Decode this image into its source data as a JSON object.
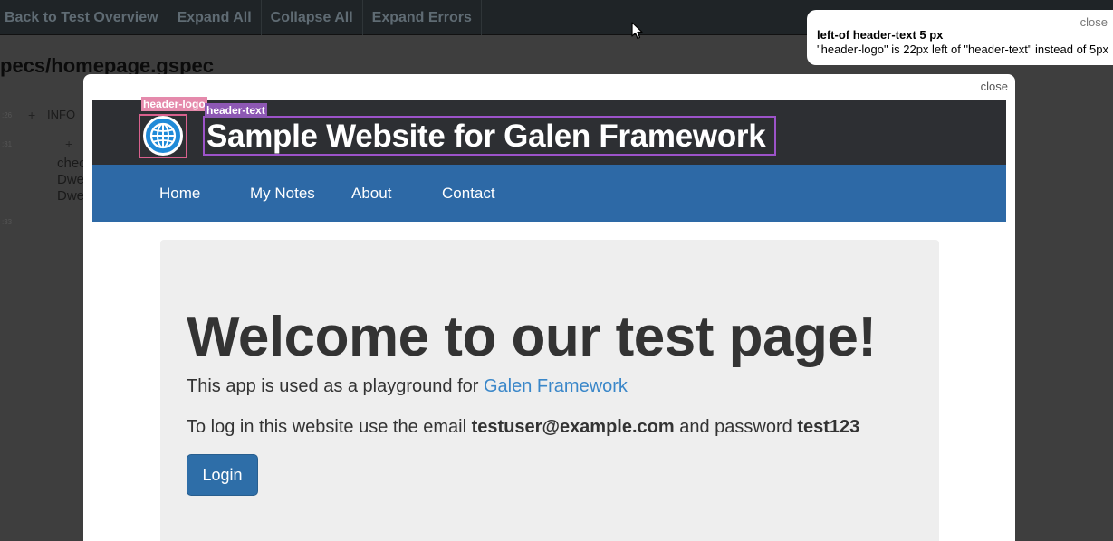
{
  "toolbar": {
    "buttons": [
      "Back to Test Overview",
      "Expand All",
      "Collapse All",
      "Expand Errors"
    ]
  },
  "report": {
    "spec_title": "pecs/homepage.gspec",
    "timestamps": [
      ":26",
      ":31",
      ":33"
    ],
    "info_label": "INFO",
    "text_fragments": [
      "chec",
      "Dwe",
      "Dwe"
    ]
  },
  "tooltip": {
    "close": "close",
    "title": "left-of header-text 5 px",
    "message": "\"header-logo\" is 22px left of \"header-text\" instead of 5px"
  },
  "modal": {
    "close": "close",
    "highlights": {
      "logo_label": "header-logo",
      "text_label": "header-text"
    },
    "site": {
      "title": "Sample Website for Galen Framework",
      "nav": [
        "Home",
        "My Notes",
        "About",
        "Contact"
      ],
      "welcome": "Welcome to our test page!",
      "intro_prefix": "This app is used as a playground for",
      "intro_link": "Galen Framework",
      "login_prefix": "To log in this website use the email",
      "email": "testuser@example.com",
      "login_middle": "and password",
      "password": "test123",
      "login_button": "Login"
    }
  },
  "colors": {
    "header_bg": "#2d2f33",
    "nav_bg": "#2d69a6",
    "logo_highlight": "#d9618d",
    "text_highlight": "#9c53c9",
    "link": "#3a87c9"
  }
}
